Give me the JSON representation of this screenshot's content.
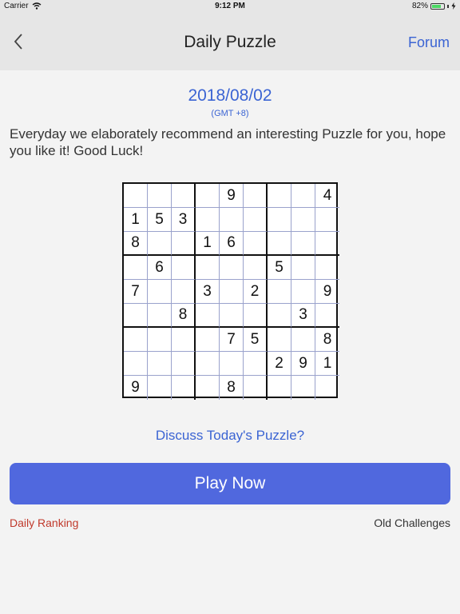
{
  "status_bar": {
    "carrier": "Carrier",
    "time": "9:12 PM",
    "battery_text": "82%",
    "battery_level": 0.82
  },
  "nav": {
    "title": "Daily Puzzle",
    "forum_label": "Forum"
  },
  "puzzle": {
    "date": "2018/08/02",
    "timezone": "(GMT +8)",
    "description": "Everyday we elaborately recommend an interesting Puzzle for you, hope you like it! Good Luck!",
    "grid": [
      [
        "",
        "",
        "",
        "",
        "9",
        "",
        "",
        "",
        "4"
      ],
      [
        "1",
        "5",
        "3",
        "",
        "",
        "",
        "",
        "",
        ""
      ],
      [
        "8",
        "",
        "",
        "1",
        "6",
        "",
        "",
        "",
        ""
      ],
      [
        "",
        "6",
        "",
        "",
        "",
        "",
        "5",
        "",
        ""
      ],
      [
        "7",
        "",
        "",
        "3",
        "",
        "2",
        "",
        "",
        "9"
      ],
      [
        "",
        "",
        "8",
        "",
        "",
        "",
        "",
        "3",
        ""
      ],
      [
        "",
        "",
        "",
        "",
        "7",
        "5",
        "",
        "",
        "8"
      ],
      [
        "",
        "",
        "",
        "",
        "",
        "",
        "2",
        "9",
        "1"
      ],
      [
        "9",
        "",
        "",
        "",
        "8",
        "",
        "",
        "",
        ""
      ]
    ]
  },
  "actions": {
    "discuss_label": "Discuss Today's Puzzle?",
    "play_label": "Play Now",
    "ranking_label": "Daily Ranking",
    "old_challenges_label": "Old Challenges"
  },
  "colors": {
    "accent": "#3b64d3",
    "button": "#5068de",
    "ranking": "#c0392b",
    "battery": "#4cd964"
  }
}
